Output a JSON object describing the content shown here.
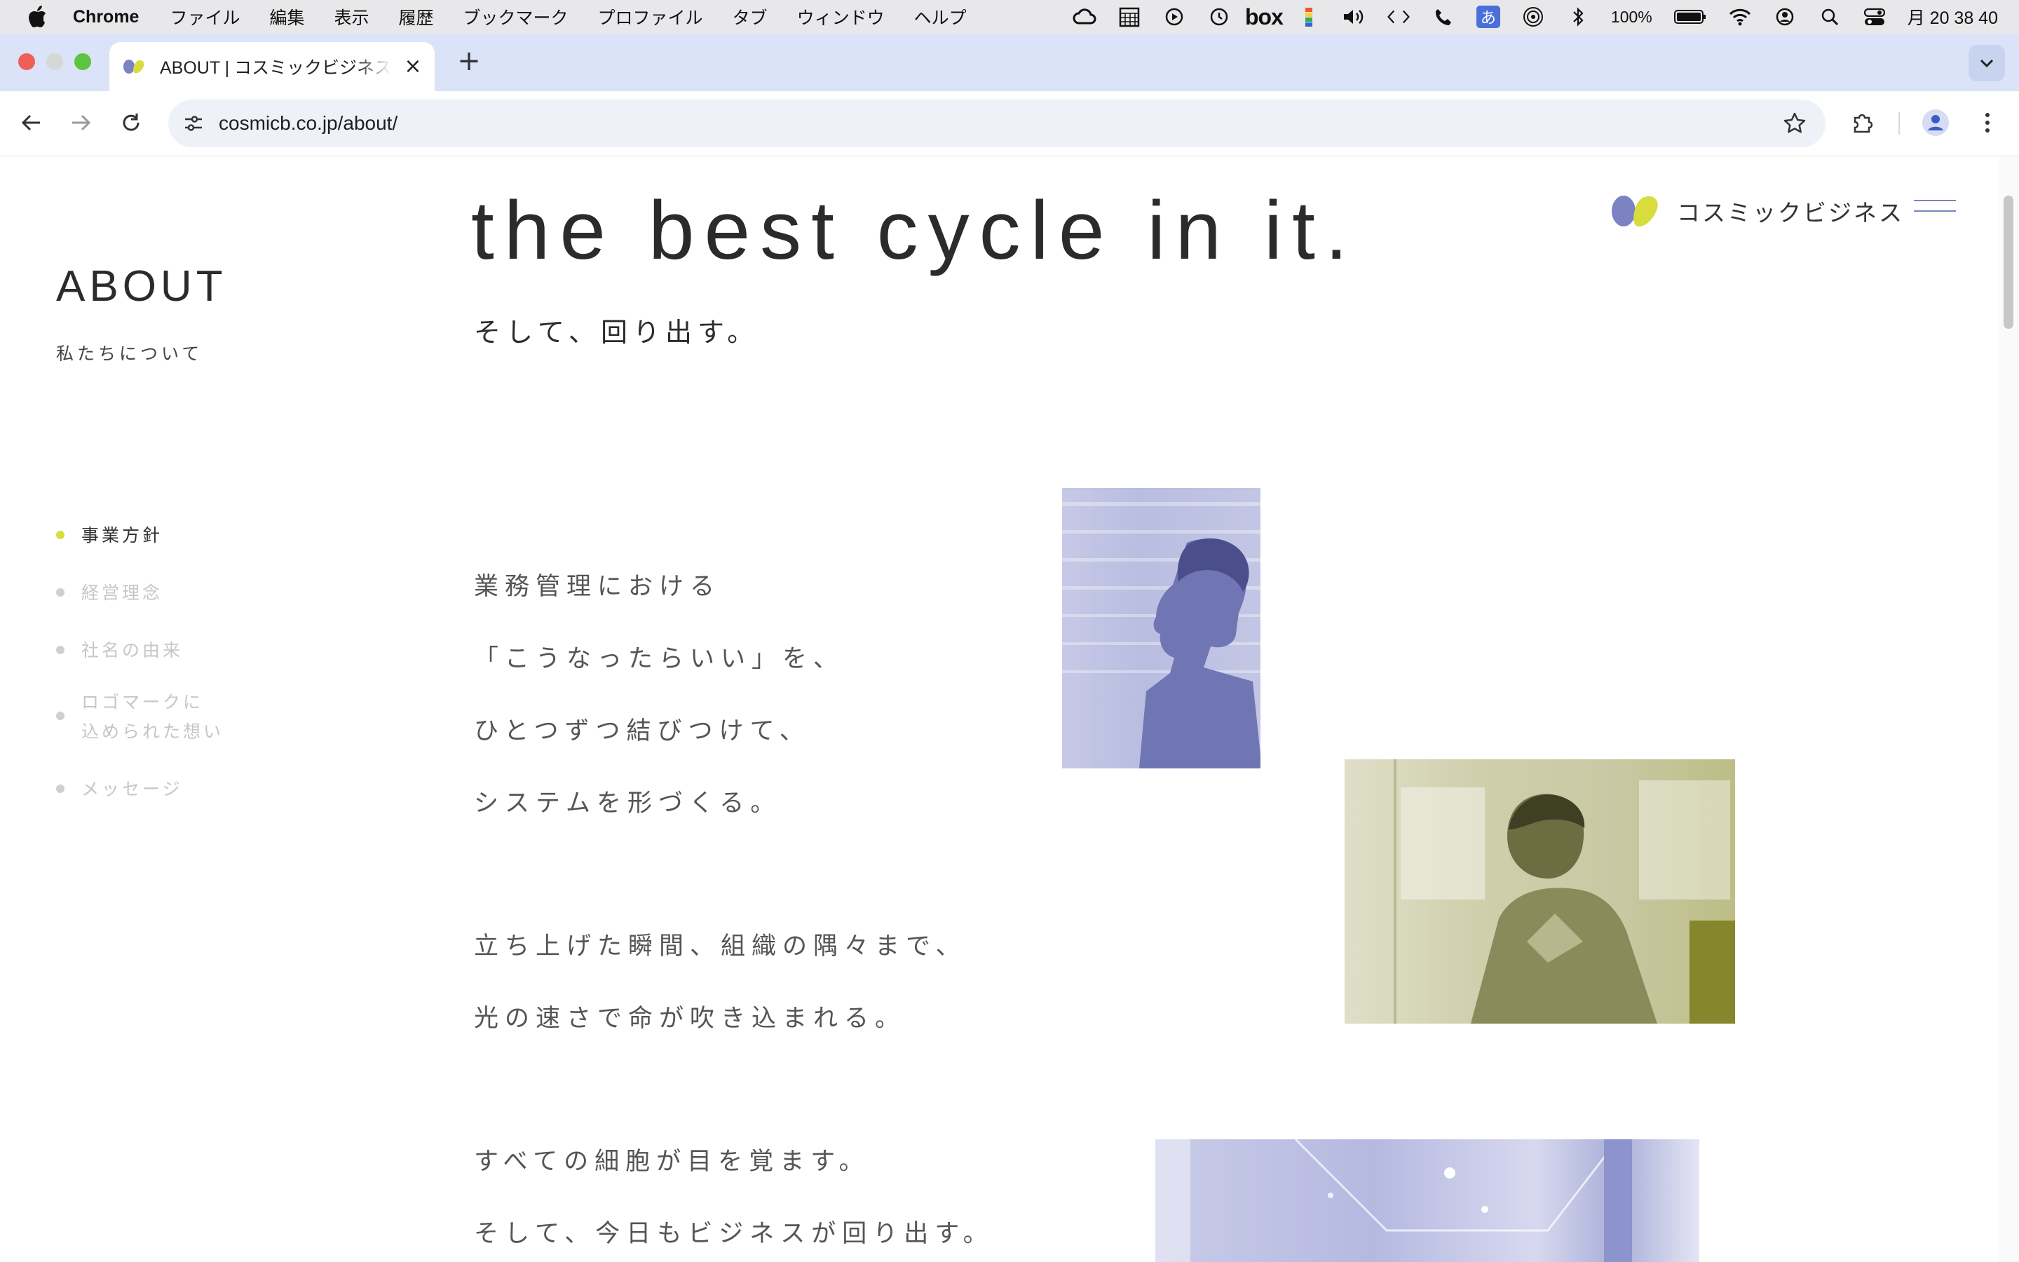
{
  "menubar": {
    "app_name": "Chrome",
    "menus": [
      "ファイル",
      "編集",
      "表示",
      "履歴",
      "ブックマーク",
      "プロファイル",
      "タブ",
      "ウィンドウ",
      "ヘルプ"
    ],
    "battery": "100%",
    "clock": "月 20 38 40",
    "box_label": "box",
    "ime_label": "あ"
  },
  "browser": {
    "tab_title": "ABOUT | コスミックビジネス株式会社",
    "url": "cosmicb.co.jp/about/"
  },
  "page": {
    "section_title": "ABOUT",
    "section_subtitle": "私たちについて",
    "headline": "the best cycle in it.",
    "subheadline": "そして、回り出す。",
    "logo_name": "コスミックビジネス",
    "nav": [
      {
        "label": "事業方針",
        "active": true
      },
      {
        "label": "経営理念",
        "active": false
      },
      {
        "label": "社名の由来",
        "active": false
      },
      {
        "label_line1": "ロゴマークに",
        "label_line2": "込められた想い",
        "active": false
      },
      {
        "label": "メッセージ",
        "active": false
      }
    ],
    "body_lines": [
      "業務管理における",
      "「こうなったらいい」を、",
      "ひとつずつ結びつけて、",
      "システムを形づくる。",
      "立ち上げた瞬間、組織の隅々まで、",
      "光の速さで命が吹き込まれる。",
      "すべての細胞が目を覚ます。",
      "そして、今日もビジネスが回り出す。"
    ]
  },
  "colors": {
    "accent_yellow": "#d8dc3c",
    "accent_blue": "#7b83c2",
    "tab_strip": "#dbe3f8"
  }
}
